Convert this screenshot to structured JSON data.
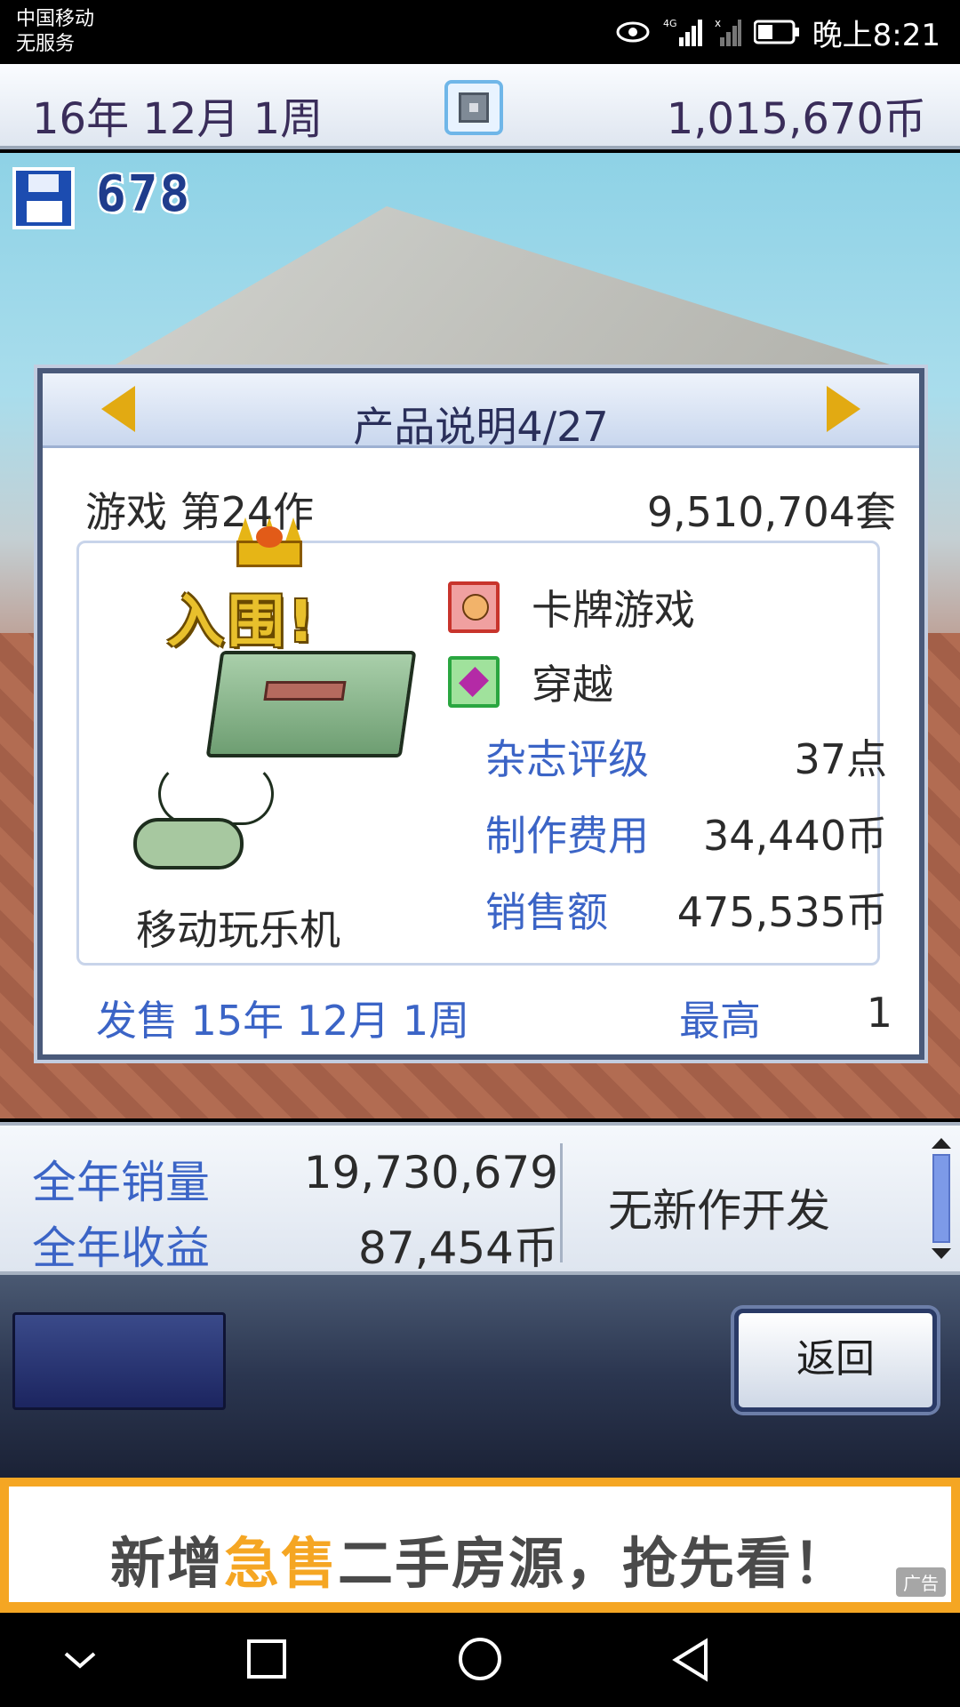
{
  "status_bar": {
    "carrier_line1": "中国移动",
    "carrier_line2": "无服务",
    "time": "晚上8:21",
    "icons": [
      "eye-icon",
      "signal-4g-icon",
      "no-signal-icon",
      "battery-icon"
    ]
  },
  "topbar": {
    "date": "16年 12月 1周",
    "money": "1,015,670币",
    "center_icon": "camera-icon"
  },
  "hud": {
    "save_count": "678",
    "save_icon": "floppy-disk-icon"
  },
  "product_panel": {
    "title": "产品说明4/27",
    "genre_line": "游戏 第24作",
    "units_sold": "9,510,704套",
    "nomination": "入围!",
    "console_name": "移动玩乐机",
    "genre_tag": "卡牌游戏",
    "theme_tag": "穿越",
    "stats": [
      {
        "label": "杂志评级",
        "value": "37点"
      },
      {
        "label": "制作费用",
        "value": "34,440币"
      },
      {
        "label": "销售额",
        "value": "475,535币"
      }
    ],
    "release": "发售 15年 12月 1周",
    "peak_label": "最高",
    "peak_rank": "1"
  },
  "yearly": {
    "sales_label": "全年销量",
    "sales_value": "19,730,679",
    "revenue_label": "全年收益",
    "revenue_value": "87,454币",
    "status": "无新作开发"
  },
  "controls": {
    "back_label": "返回"
  },
  "ad": {
    "text_before": "新增",
    "text_highlight": "急售",
    "text_after": "二手房源，抢先看！",
    "tag": "广告",
    "accent_color": "#f5a623"
  }
}
